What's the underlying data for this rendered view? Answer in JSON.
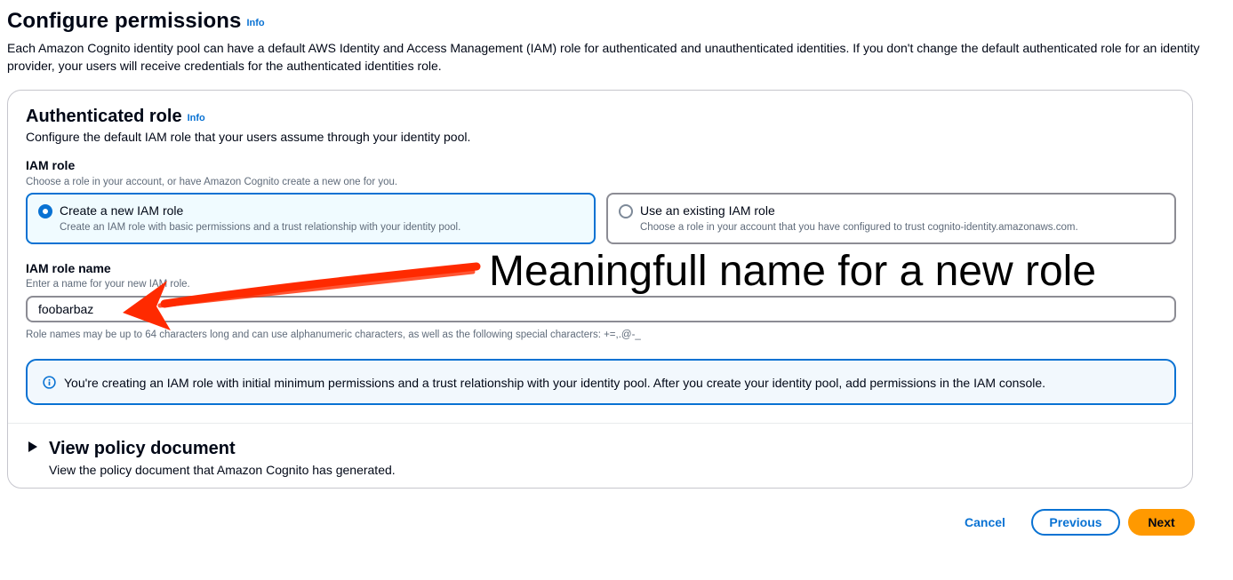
{
  "header": {
    "title": "Configure permissions",
    "info": "Info",
    "description": "Each Amazon Cognito identity pool can have a default AWS Identity and Access Management (IAM) role for authenticated and unauthenticated identities. If you don't change the default authenticated role for an identity provider, your users will receive credentials for the authenticated identities role."
  },
  "auth_role": {
    "title": "Authenticated role",
    "info": "Info",
    "description": "Configure the default IAM role that your users assume through your identity pool.",
    "iam_role": {
      "label": "IAM role",
      "description": "Choose a role in your account, or have Amazon Cognito create a new one for you.",
      "options": [
        {
          "label": "Create a new IAM role",
          "description": "Create an IAM role with basic permissions and a trust relationship with your identity pool.",
          "selected": true
        },
        {
          "label": "Use an existing IAM role",
          "description": "Choose a role in your account that you have configured to trust cognito-identity.amazonaws.com.",
          "selected": false
        }
      ]
    },
    "role_name": {
      "label": "IAM role name",
      "description": "Enter a name for your new IAM role.",
      "value": "foobarbaz",
      "constraint": "Role names may be up to 64 characters long and can use alphanumeric characters, as well as the following special characters: +=,.@-_"
    },
    "alert": "You're creating an IAM role with initial minimum permissions and a trust relationship with your identity pool. After you create your identity pool, add permissions in the IAM console."
  },
  "policy_document": {
    "title": "View policy document",
    "description": "View the policy document that Amazon Cognito has generated."
  },
  "footer": {
    "cancel": "Cancel",
    "previous": "Previous",
    "next": "Next"
  },
  "annotation": {
    "text": "Meaningfull name for a new role",
    "color": "#ff2a00"
  },
  "colors": {
    "accent": "#0972d3",
    "primary_button": "#ff9900"
  }
}
